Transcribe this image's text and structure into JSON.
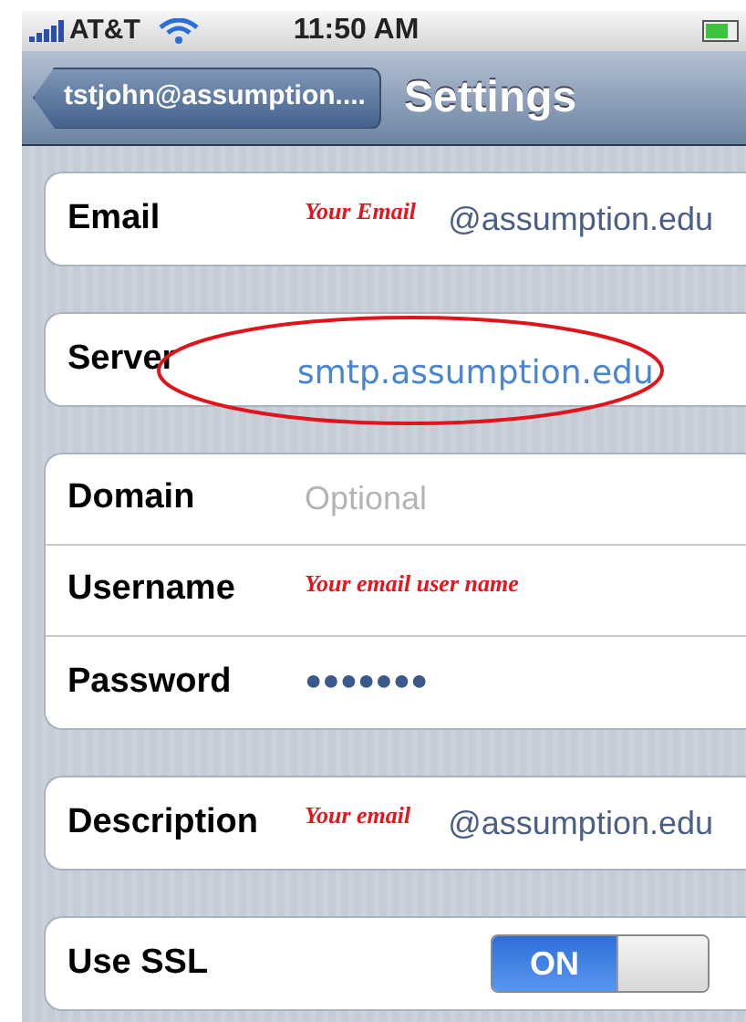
{
  "status_bar": {
    "carrier": "AT&T",
    "time": "11:50 AM"
  },
  "nav_bar": {
    "back": "tstjohn@assumption....",
    "title": "Settings"
  },
  "groups": [
    {
      "rows": [
        {
          "kind": "field",
          "label": "Email",
          "note": "Your Email",
          "value": "@assumption.edu",
          "circled": false
        }
      ]
    },
    {
      "rows": [
        {
          "kind": "field",
          "label": "Server",
          "value": "smtp.assumption.edu",
          "circled": true
        }
      ]
    },
    {
      "rows": [
        {
          "kind": "field",
          "label": "Domain",
          "placeholder": "Optional",
          "circled": false
        },
        {
          "kind": "field",
          "label": "Username",
          "note": "Your email user name",
          "circled": false
        },
        {
          "kind": "password",
          "label": "Password",
          "value": "●●●●●●●",
          "circled": false
        }
      ]
    },
    {
      "rows": [
        {
          "kind": "field",
          "label": "Description",
          "note": "Your email",
          "value": "@assumption.edu",
          "circled": false
        }
      ]
    },
    {
      "rows": [
        {
          "kind": "toggle",
          "label": "Use SSL",
          "on": true,
          "on_text": "ON"
        }
      ]
    }
  ]
}
